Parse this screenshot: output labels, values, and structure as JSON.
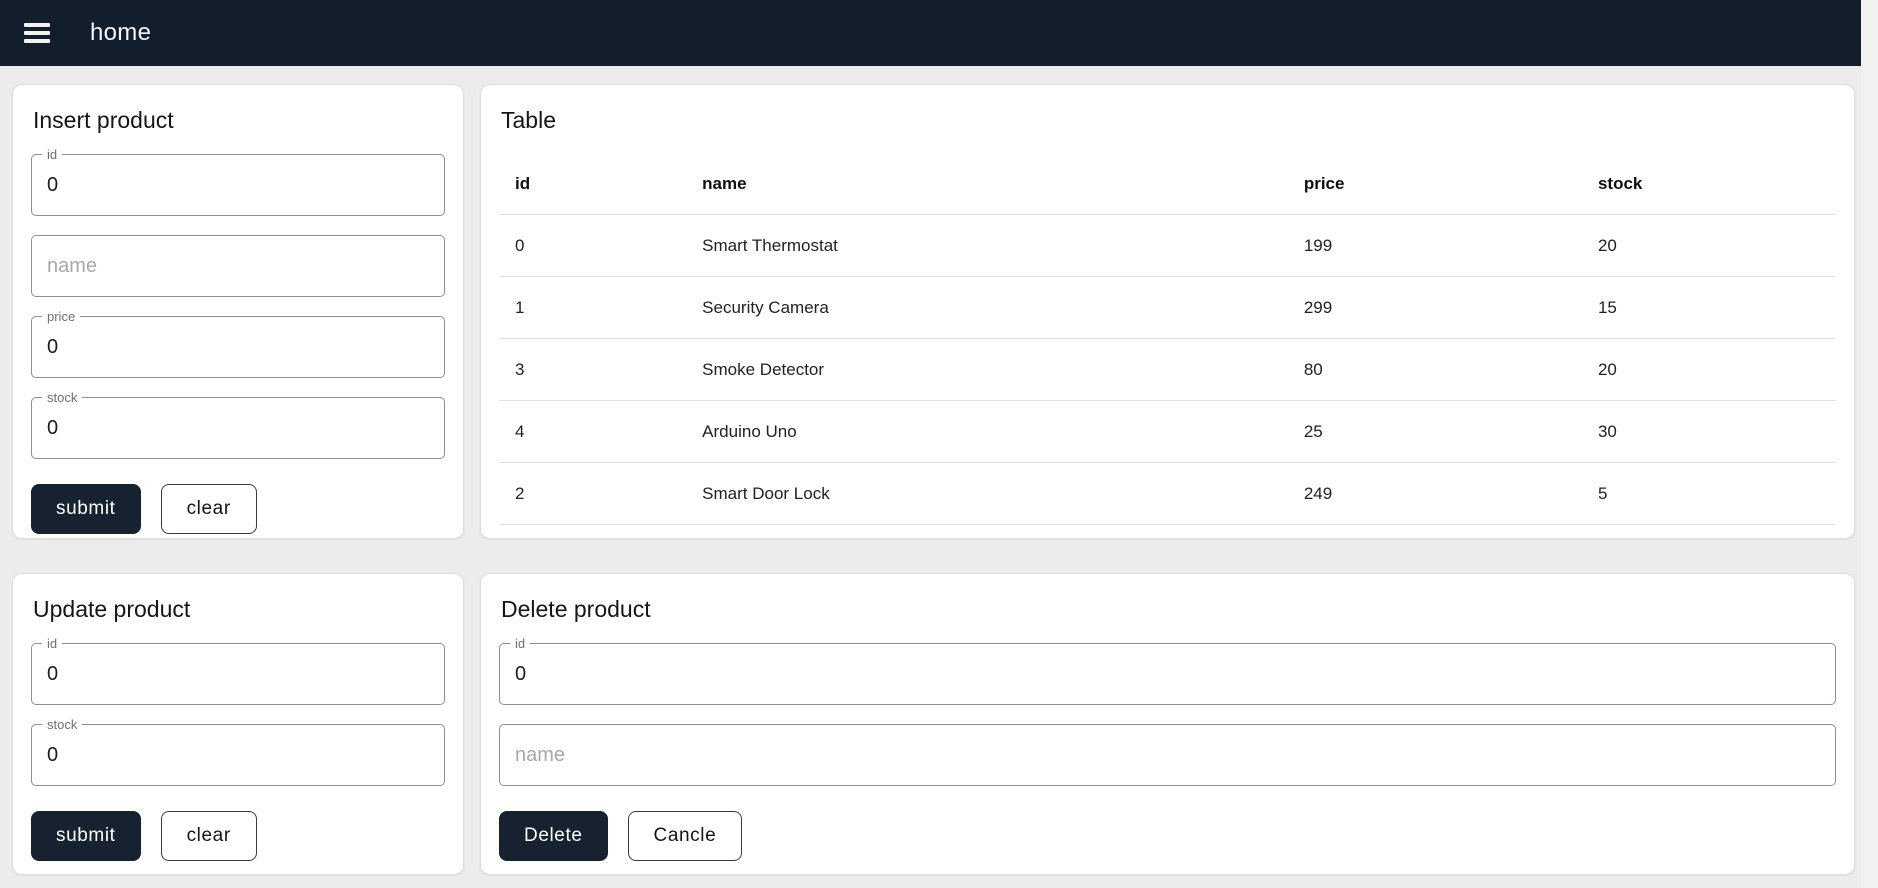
{
  "navbar": {
    "title": "home",
    "menu_icon": "hamburger-icon"
  },
  "colors": {
    "navbar_bg": "#121e2c",
    "primary_button_bg": "#16222f",
    "page_bg": "#ececec",
    "field_border": "#8f8f8f",
    "divider": "#e2e2e2"
  },
  "insert_card": {
    "title": "Insert product",
    "id_field": {
      "label": "id",
      "value": "0"
    },
    "name_field": {
      "placeholder": "name",
      "value": ""
    },
    "price_field": {
      "label": "price",
      "value": "0"
    },
    "stock_field": {
      "label": "stock",
      "value": "0"
    },
    "submit_label": "submit",
    "clear_label": "clear"
  },
  "table_card": {
    "title": "Table",
    "columns": [
      "id",
      "name",
      "price",
      "stock"
    ],
    "rows": [
      [
        "0",
        "Smart Thermostat",
        "199",
        "20"
      ],
      [
        "1",
        "Security Camera",
        "299",
        "15"
      ],
      [
        "3",
        "Smoke Detector",
        "80",
        "20"
      ],
      [
        "4",
        "Arduino Uno",
        "25",
        "30"
      ],
      [
        "2",
        "Smart Door Lock",
        "249",
        "5"
      ]
    ]
  },
  "update_card": {
    "title": "Update product",
    "id_field": {
      "label": "id",
      "value": "0"
    },
    "stock_field": {
      "label": "stock",
      "value": "0"
    },
    "submit_label": "submit",
    "clear_label": "clear"
  },
  "delete_card": {
    "title": "Delete product",
    "id_field": {
      "label": "id",
      "value": "0"
    },
    "name_field": {
      "placeholder": "name",
      "value": ""
    },
    "delete_label": "Delete",
    "cancel_label": "Cancle"
  }
}
